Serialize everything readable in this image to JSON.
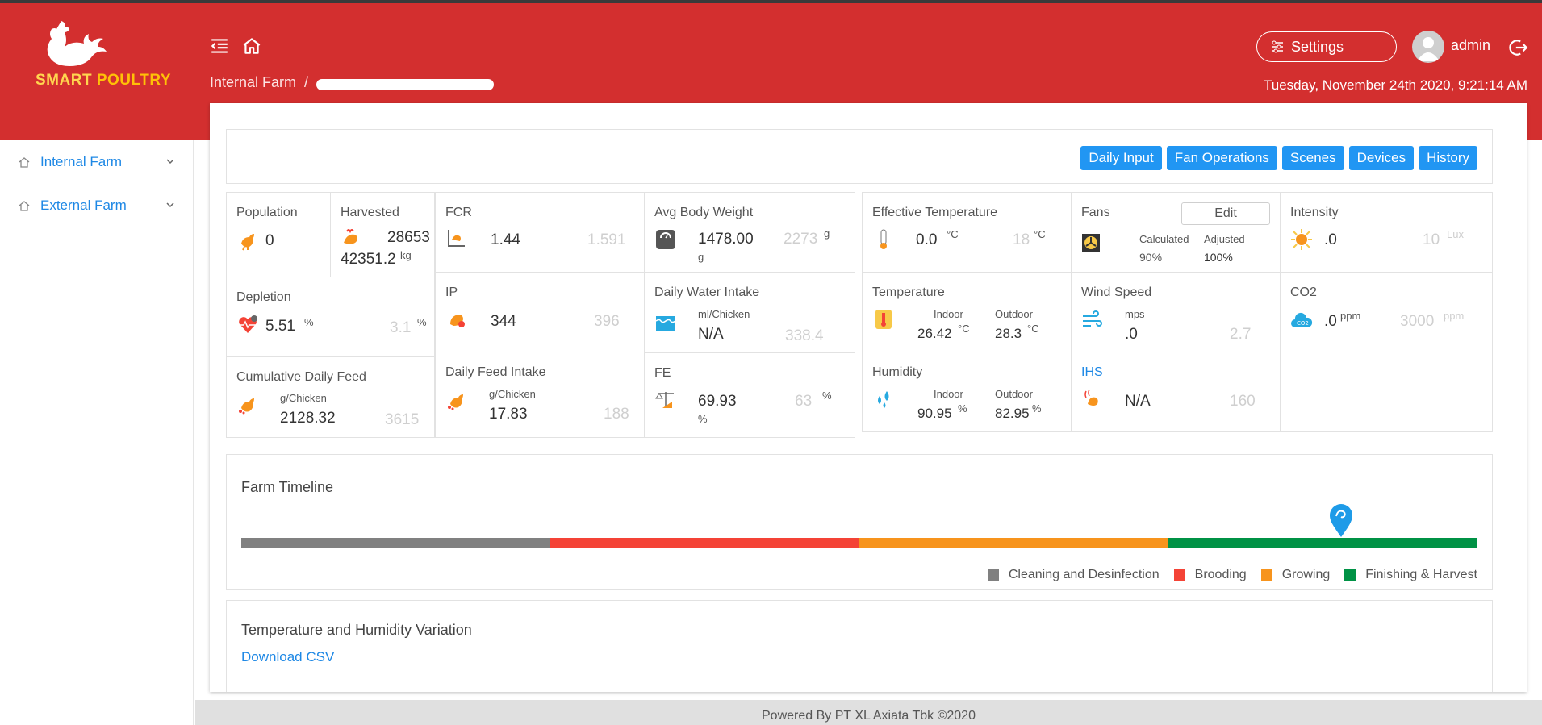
{
  "brand": {
    "logo_smart": "SMART",
    "logo_poultry": "POULTRY"
  },
  "header": {
    "breadcrumb_root": "Internal Farm",
    "breadcrumb_sep": "/",
    "settings_label": "Settings",
    "username": "admin",
    "datetime": "Tuesday, November 24th 2020, 9:21:14 AM"
  },
  "sidebar": {
    "items": [
      {
        "label": "Internal Farm"
      },
      {
        "label": "External Farm"
      }
    ]
  },
  "actions": [
    "Daily Input",
    "Fan Operations",
    "Scenes",
    "Devices",
    "History"
  ],
  "metrics": {
    "population": {
      "title": "Population",
      "value": "0"
    },
    "harvested": {
      "title": "Harvested",
      "value": "28653",
      "weight": "42351.2",
      "unit": "kg"
    },
    "depletion": {
      "title": "Depletion",
      "value": "5.51",
      "unit": "%",
      "target": "3.1",
      "target_unit": "%"
    },
    "cumulative_feed": {
      "title": "Cumulative Daily Feed",
      "sub": "g/Chicken",
      "value": "2128.32",
      "target": "3615"
    },
    "fcr": {
      "title": "FCR",
      "value": "1.44",
      "target": "1.591"
    },
    "ip": {
      "title": "IP",
      "value": "344",
      "target": "396"
    },
    "daily_feed": {
      "title": "Daily Feed Intake",
      "sub": "g/Chicken",
      "value": "17.83",
      "target": "188"
    },
    "avg_weight": {
      "title": "Avg Body Weight",
      "value": "1478.00",
      "unit": "g",
      "target": "2273",
      "target_unit": "g"
    },
    "water": {
      "title": "Daily Water Intake",
      "sub": "ml/Chicken",
      "value": "N/A",
      "target": "338.4"
    },
    "fe": {
      "title": "FE",
      "value": "69.93",
      "unit": "%",
      "target": "63",
      "target_unit": "%"
    },
    "eff_temp": {
      "title": "Effective Temperature",
      "value": "0.0",
      "unit": "°C",
      "target": "18",
      "target_unit": "°C"
    },
    "temperature": {
      "title": "Temperature",
      "indoor_label": "Indoor",
      "outdoor_label": "Outdoor",
      "indoor": "26.42",
      "outdoor": "28.3",
      "unit": "°C"
    },
    "humidity": {
      "title": "Humidity",
      "indoor_label": "Indoor",
      "outdoor_label": "Outdoor",
      "indoor": "90.95",
      "outdoor": "82.95",
      "unit": "%"
    },
    "fans": {
      "title": "Fans",
      "edit": "Edit",
      "calc_label": "Calculated",
      "adj_label": "Adjusted",
      "calc": "90%",
      "adj": "100%"
    },
    "wind": {
      "title": "Wind Speed",
      "sub": "mps",
      "value": ".0",
      "target": "2.7"
    },
    "ihs": {
      "title": "IHS",
      "value": "N/A",
      "target": "160"
    },
    "intensity": {
      "title": "Intensity",
      "value": ".0",
      "target": "10",
      "target_unit": "Lux"
    },
    "co2": {
      "title": "CO2",
      "value": ".0",
      "unit": "ppm",
      "target": "3000",
      "target_unit": "ppm"
    }
  },
  "timeline": {
    "title": "Farm Timeline",
    "phases": [
      {
        "name": "Cleaning and Desinfection",
        "color": "#808080"
      },
      {
        "name": "Brooding",
        "color": "#f44336"
      },
      {
        "name": "Growing",
        "color": "#f7941d"
      },
      {
        "name": "Finishing & Harvest",
        "color": "#009245"
      }
    ],
    "marker_progress": 0.89
  },
  "variation": {
    "title": "Temperature and Humidity Variation",
    "download": "Download CSV"
  },
  "footer": {
    "text": "Powered By PT XL Axiata Tbk ©2020"
  },
  "colors": {
    "header": "#d32f2f",
    "accent": "#2196f3",
    "link": "#1e88e5"
  }
}
